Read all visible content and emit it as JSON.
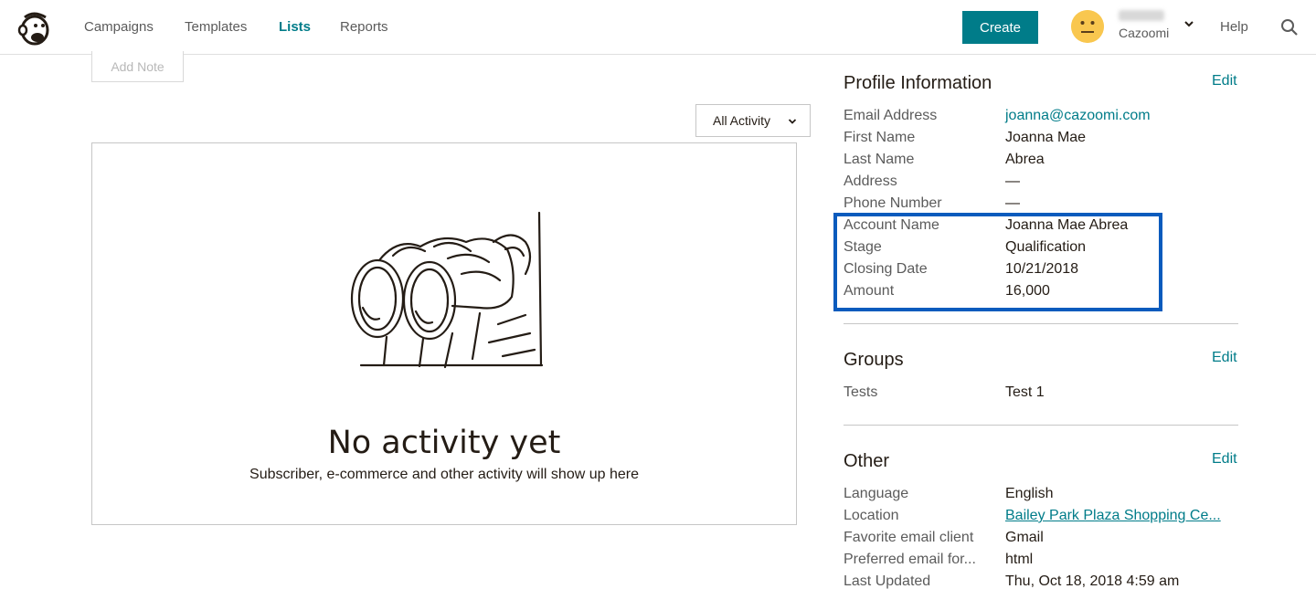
{
  "nav": {
    "items": [
      {
        "label": "Campaigns",
        "active": false
      },
      {
        "label": "Templates",
        "active": false
      },
      {
        "label": "Lists",
        "active": true
      },
      {
        "label": "Reports",
        "active": false
      }
    ],
    "create_label": "Create",
    "org_name": "Cazoomi",
    "help_label": "Help",
    "accent_color": "#007c89"
  },
  "activity": {
    "add_note_label": "Add Note",
    "filter_selected": "All Activity",
    "empty_title": "No activity yet",
    "empty_subtitle": "Subscriber, e-commerce and other activity will show up here"
  },
  "profile": {
    "title": "Profile Information",
    "edit_label": "Edit",
    "fields": [
      {
        "label": "Email Address",
        "value": "joanna@cazoomi.com"
      },
      {
        "label": "First Name",
        "value": "Joanna Mae"
      },
      {
        "label": "Last Name",
        "value": "Abrea"
      },
      {
        "label": "Address",
        "value": "—"
      },
      {
        "label": "Phone Number",
        "value": "—"
      },
      {
        "label": "Account Name",
        "value": "Joanna Mae Abrea"
      },
      {
        "label": "Stage",
        "value": "Qualification"
      },
      {
        "label": "Closing Date",
        "value": "10/21/2018"
      },
      {
        "label": "Amount",
        "value": "16,000"
      }
    ],
    "highlight_color": "#0a5bbd"
  },
  "groups": {
    "title": "Groups",
    "edit_label": "Edit",
    "fields": [
      {
        "label": "Tests",
        "value": "Test 1"
      }
    ]
  },
  "other": {
    "title": "Other",
    "edit_label": "Edit",
    "fields": [
      {
        "label": "Language",
        "value": "English"
      },
      {
        "label": "Location",
        "value": "Bailey Park Plaza Shopping Ce..."
      },
      {
        "label": "Favorite email client",
        "value": "Gmail"
      },
      {
        "label": "Preferred email for...",
        "value": "html"
      },
      {
        "label": "Last Updated",
        "value": "Thu, Oct 18, 2018 4:59 am"
      }
    ]
  },
  "icons": {
    "logo": "mailchimp-logo-icon",
    "avatar": "neutral-face-icon",
    "user_menu": "chevron-down-icon",
    "search": "search-icon",
    "filter_caret": "chevron-down-icon",
    "empty_state": "binoculars-icon"
  }
}
